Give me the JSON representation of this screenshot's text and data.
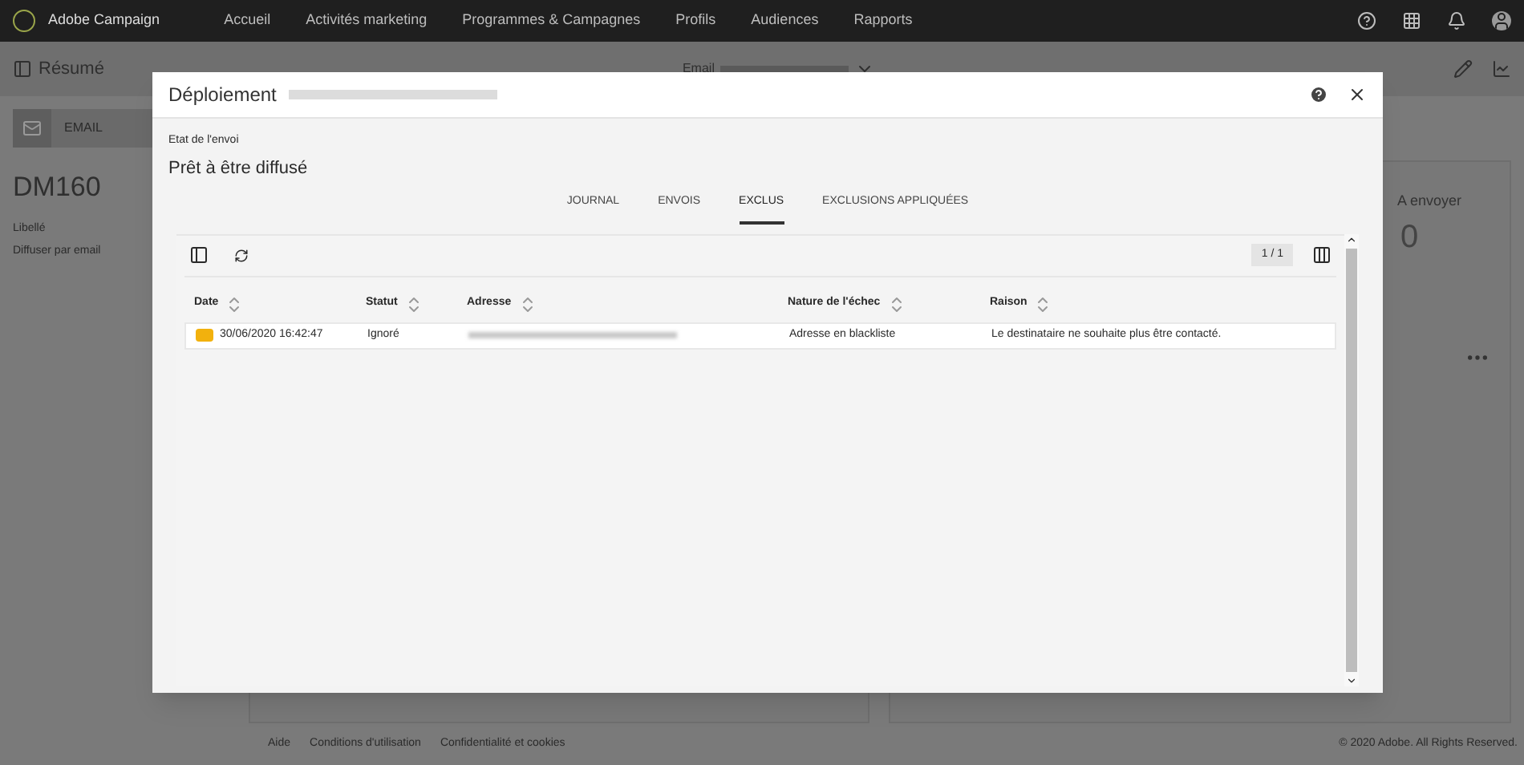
{
  "app": {
    "name": "Adobe Campaign"
  },
  "nav": [
    {
      "label": "Accueil"
    },
    {
      "label": "Activités marketing"
    },
    {
      "label": "Programmes & Campagnes"
    },
    {
      "label": "Profils"
    },
    {
      "label": "Audiences"
    },
    {
      "label": "Rapports"
    }
  ],
  "subheader": {
    "title": "Résumé",
    "center_label": "Email"
  },
  "summary": {
    "type_label": "EMAIL",
    "id": "DM160",
    "field_label": "Libellé",
    "field_value": "Diffuser par email"
  },
  "stats": {
    "label": "A envoyer",
    "value": "0"
  },
  "dialog": {
    "title": "Déploiement",
    "status_label": "Etat de l'envoi",
    "status_value": "Prêt à être diffusé",
    "tabs": [
      {
        "label": "JOURNAL",
        "selected": false
      },
      {
        "label": "ENVOIS",
        "selected": false
      },
      {
        "label": "EXCLUS",
        "selected": true
      },
      {
        "label": "EXCLUSIONS APPLIQUÉES",
        "selected": false
      }
    ],
    "pager": "1 / 1",
    "columns": [
      "Date",
      "Statut",
      "Adresse",
      "Nature de l'échec",
      "Raison"
    ],
    "rows": [
      {
        "kind": "warning",
        "date": "30/06/2020 16:42:47",
        "status": "Ignoré",
        "failure": "Adresse en blackliste",
        "reason": "Le destinataire ne souhaite plus être contacté."
      }
    ]
  },
  "footer": {
    "links": [
      "Aide",
      "Conditions d'utilisation",
      "Confidentialité et cookies"
    ],
    "copyright": "© 2020 Adobe. All Rights Reserved."
  }
}
